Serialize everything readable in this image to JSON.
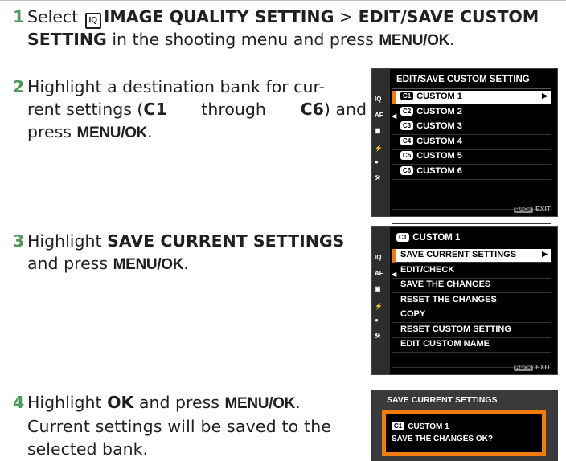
{
  "step1": {
    "number": "1",
    "pre": "Select ",
    "icon_name": "image-quality-icon",
    "icon_text": "IQ",
    "menu_path": "IMAGE QUALITY SETTING",
    "separator": " > ",
    "item": "EDIT/SAVE CUSTOM SETTING",
    "mid": " in the shooting menu and press ",
    "key": "MENU/OK",
    "end": "."
  },
  "step2": {
    "number": "2",
    "line1": "Highlight a destination bank for cur-",
    "line2_pre": "rent settings (",
    "c1": "C1",
    "through": " through ",
    "c6": "C6",
    "line2_post": ") and",
    "line3_pre": "press ",
    "key": "MENU/OK",
    "end": "."
  },
  "step3": {
    "number": "3",
    "pre": "Highlight ",
    "item": "SAVE CURRENT SETTINGS",
    "line2_pre": "and press ",
    "key": "MENU/OK",
    "end": "."
  },
  "step4": {
    "number": "4",
    "pre": "Highlight ",
    "ok": "OK",
    "mid": " and press ",
    "key": "MENU/OK",
    "end": ".",
    "line2": "Current settings will be saved to the",
    "line3": "selected bank."
  },
  "screen1": {
    "title": "EDIT/SAVE CUSTOM SETTING",
    "items": [
      {
        "chip": "C1",
        "label": "CUSTOM 1"
      },
      {
        "chip": "C2",
        "label": "CUSTOM 2"
      },
      {
        "chip": "C3",
        "label": "CUSTOM 3"
      },
      {
        "chip": "C4",
        "label": "CUSTOM 4"
      },
      {
        "chip": "C5",
        "label": "CUSTOM 5"
      },
      {
        "chip": "C6",
        "label": "CUSTOM 6"
      }
    ],
    "footer_key": "BACK",
    "footer": "EXIT"
  },
  "screen2": {
    "chip": "C1",
    "title": "CUSTOM 1",
    "items": [
      "SAVE CURRENT SETTINGS",
      "EDIT/CHECK",
      "SAVE THE CHANGES",
      "RESET THE CHANGES",
      "COPY",
      "RESET CUSTOM SETTING",
      "EDIT CUSTOM NAME"
    ],
    "footer_key": "BACK",
    "footer": "EXIT"
  },
  "screen3": {
    "title": "SAVE CURRENT SETTINGS",
    "chip": "C1",
    "line1": "CUSTOM 1",
    "line2": "SAVE THE CHANGES OK?"
  },
  "sidebar_icons": [
    "IQ",
    "AF MF",
    "camera-icon",
    "flash-icon",
    "movie-icon",
    "wrench-icon"
  ],
  "colors": {
    "step_number": "#4f9a5a",
    "highlight": "#f07c10"
  }
}
